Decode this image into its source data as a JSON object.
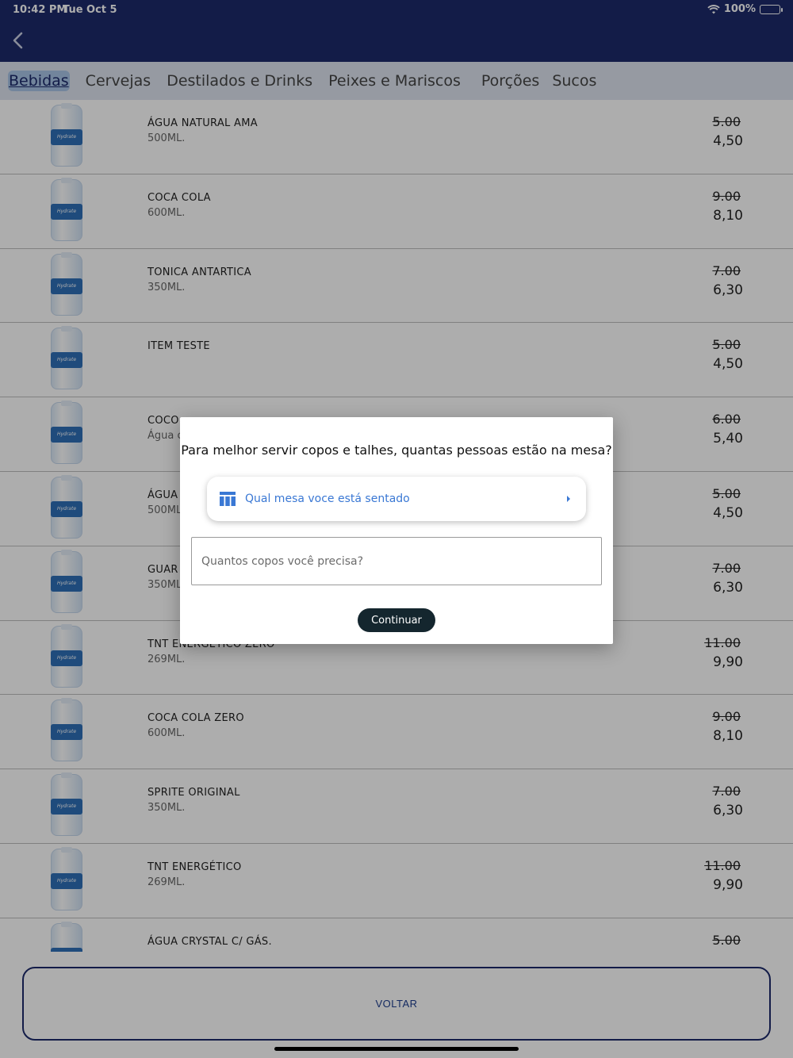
{
  "status_bar": {
    "time": "10:42 PM",
    "date": "Tue Oct 5",
    "battery": "100%"
  },
  "tabs": [
    {
      "label": "Bebidas",
      "active": true
    },
    {
      "label": "Cervejas"
    },
    {
      "label": "Destilados e Drinks"
    },
    {
      "label": "Peixes e Mariscos"
    },
    {
      "label": "Porções"
    },
    {
      "label": "Sucos"
    }
  ],
  "bottle_label": "Hydrate",
  "products": [
    {
      "name": "ÁGUA NATURAL AMA",
      "desc": "500ML.",
      "price_old": "5.00",
      "price_new": "4,50"
    },
    {
      "name": "COCA COLA",
      "desc": "600ML.",
      "price_old": "9.00",
      "price_new": "8,10"
    },
    {
      "name": "TONICA ANTARTICA",
      "desc": "350ML.",
      "price_old": "7.00",
      "price_new": "6,30"
    },
    {
      "name": "ITEM TESTE",
      "desc": "",
      "price_old": "5.00",
      "price_new": "4,50"
    },
    {
      "name": "COCO",
      "desc": "Água c",
      "price_old": "6.00",
      "price_new": "5,40"
    },
    {
      "name": "ÁGUA",
      "desc": "500ML",
      "price_old": "5.00",
      "price_new": "4,50"
    },
    {
      "name": "GUAR",
      "desc": "350ML",
      "price_old": "7.00",
      "price_new": "6,30"
    },
    {
      "name": "TNT ENERGÉTICO ZERO",
      "desc": "269ML.",
      "price_old": "11.00",
      "price_new": "9,90"
    },
    {
      "name": "COCA COLA ZERO",
      "desc": "600ML.",
      "price_old": "9.00",
      "price_new": "8,10"
    },
    {
      "name": "SPRITE ORIGINAL",
      "desc": "350ML.",
      "price_old": "7.00",
      "price_new": "6,30"
    },
    {
      "name": "TNT ENERGÉTICO",
      "desc": "269ML.",
      "price_old": "11.00",
      "price_new": "9,90"
    },
    {
      "name": "ÁGUA CRYSTAL C/ GÁS.",
      "desc": "",
      "price_old": "5.00",
      "price_new": ""
    }
  ],
  "footer": {
    "back_label": "VOLTAR"
  },
  "dialog": {
    "title": "Para melhor servir copos e talhes, quantas pessoas estão na mesa?",
    "table_select_label": "Qual mesa voce está sentado",
    "copos_placeholder": "Quantos copos você precisa?",
    "continue_label": "Continuar"
  },
  "colors": {
    "navbar": "#1c2a6b",
    "accent": "#3a78d4",
    "button_dark": "#14262e"
  }
}
